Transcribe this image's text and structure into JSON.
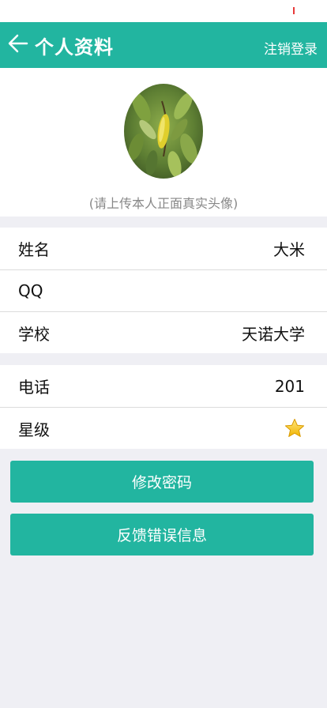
{
  "header": {
    "title": "个人资料",
    "logout_label": "注销登录",
    "back_icon": "arrow-left-icon"
  },
  "avatar": {
    "hint": "(请上传本人正面真实头像)"
  },
  "profile_group_1": [
    {
      "label": "姓名",
      "value": "大米"
    },
    {
      "label": "QQ",
      "value": ""
    },
    {
      "label": "学校",
      "value": "天诺大学"
    }
  ],
  "profile_group_2": [
    {
      "label": "电话",
      "value": "201"
    },
    {
      "label": "星级",
      "value_icon": "star-icon",
      "rating": 1
    }
  ],
  "buttons": {
    "change_password": "修改密码",
    "feedback": "反馈错误信息"
  },
  "colors": {
    "primary": "#22b5a0",
    "background": "#efeff4",
    "star": "#f5c518"
  }
}
